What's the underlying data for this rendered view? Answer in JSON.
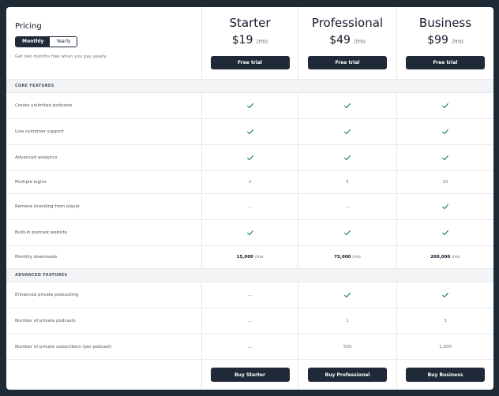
{
  "header": {
    "title": "Pricing",
    "toggle": {
      "monthly": "Monthly",
      "yearly": "Yearly"
    },
    "promo": "Get two months free when you pay yearly."
  },
  "plans": [
    {
      "name": "Starter",
      "price": "$19",
      "period": "/mo",
      "trial": "Free trial",
      "buy": "Buy Starter"
    },
    {
      "name": "Professional",
      "price": "$49",
      "period": "/mo",
      "trial": "Free trial",
      "buy": "Buy Professional"
    },
    {
      "name": "Business",
      "price": "$99",
      "period": "/mo",
      "trial": "Free trial",
      "buy": "Buy Business"
    }
  ],
  "sections": [
    {
      "title": "CORE FEATURES",
      "rows": [
        {
          "label": "Create unlimited podcasts",
          "values": [
            "check",
            "check",
            "check"
          ]
        },
        {
          "label": "Live customer support",
          "values": [
            "check",
            "check",
            "check"
          ]
        },
        {
          "label": "Advanced analytics",
          "values": [
            "check",
            "check",
            "check"
          ]
        },
        {
          "label": "Multiple logins",
          "values": [
            "2",
            "5",
            "10"
          ]
        },
        {
          "label": "Remove branding from player",
          "values": [
            "dash",
            "dash",
            "check"
          ]
        },
        {
          "label": "Built-in podcast website",
          "values": [
            "check",
            "check",
            "check"
          ]
        },
        {
          "label": "Monthly downloads",
          "values": [
            "15,000",
            "75,000",
            "200,000"
          ],
          "unit": "/mo"
        }
      ]
    },
    {
      "title": "ADVANCED FEATURES",
      "rows": [
        {
          "label": "Enhanced private podcasting",
          "values": [
            "dash",
            "check",
            "check"
          ]
        },
        {
          "label": "Number of private podcasts",
          "values": [
            "dash",
            "1",
            "3"
          ]
        },
        {
          "label": "Number of private subscribers (per podcast)",
          "values": [
            "dash",
            "500",
            "1,000"
          ]
        }
      ]
    }
  ],
  "colors": {
    "check": "#15803d",
    "button": "#1f2937",
    "background": "#1e2b35"
  }
}
